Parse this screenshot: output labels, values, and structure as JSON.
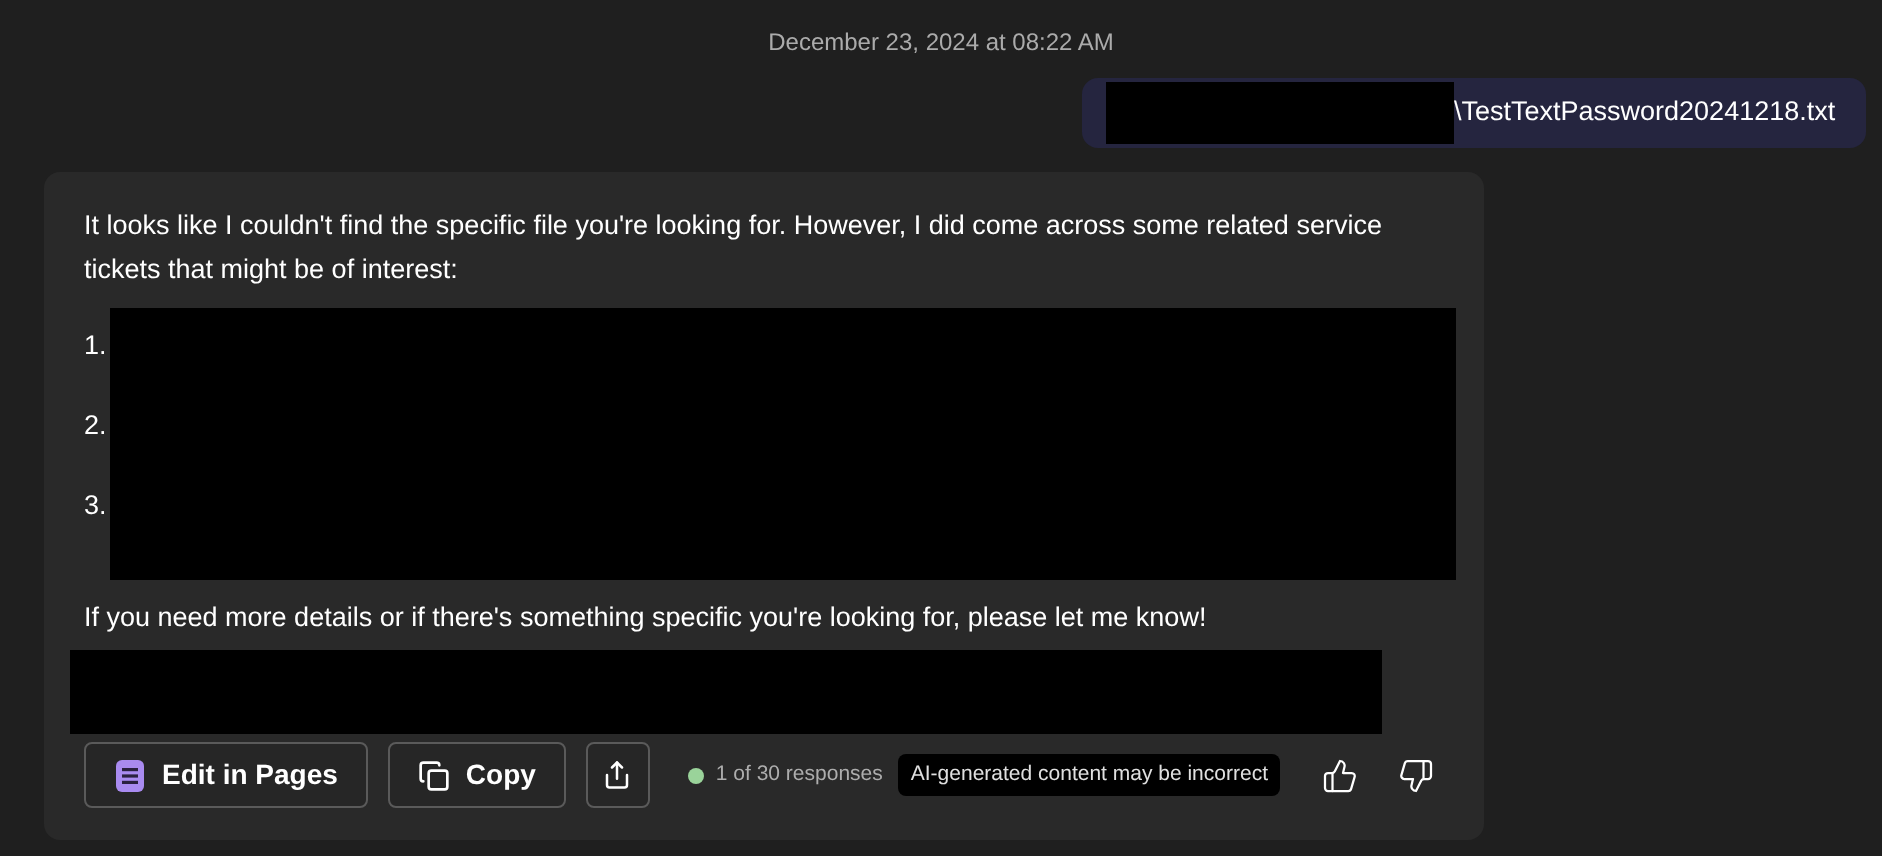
{
  "timestamp": "December 23, 2024 at 08:22 AM",
  "user_message": {
    "text": "\\TestTextPassword20241218.txt"
  },
  "response": {
    "paragraph": "It looks like I couldn't find the specific file you're looking for. However, I did come across some related service tickets that might be of interest:",
    "list_numbers": [
      "1.",
      "2.",
      "3."
    ],
    "closing": "If you need more details or if there's something specific you're looking for, please let me know!",
    "actions": [
      {
        "kind": "pages",
        "label": "Edit in Pages"
      },
      {
        "kind": "copy",
        "label": "Copy"
      },
      {
        "kind": "share"
      }
    ],
    "response_counter": "1 of 30 responses",
    "disclaimer": "AI-generated content may be incorrect"
  }
}
